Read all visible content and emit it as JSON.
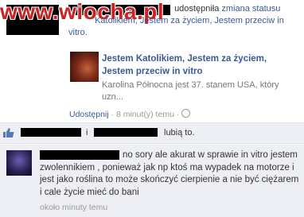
{
  "watermark": {
    "text": "www.wiocha.pl"
  },
  "post": {
    "verb": "udostępniła",
    "link_label": "zmiana statusu",
    "shared_title_visible": "Katolikiem, Jestem za życiem, Jestem przeciw in vitro."
  },
  "link_card": {
    "title": "Jestem Katolikiem, Jestem za życiem, Jestem przeciw in vitro",
    "description": "Karolina Północna jest 37. stanem USA, który uzn..."
  },
  "meta": {
    "share": "Udostępnij",
    "sep": "·",
    "time": "8 minut(y) temu",
    "sep2": "·"
  },
  "likes": {
    "connector": "i",
    "suffix": "lubią to."
  },
  "comment": {
    "text": "no sory ale akurat w sprawie in vitro jestem zwolennikiem , ponieważ jak np ktoś ma wypadek na motorze i jest jako roślina to może skończyć cierpienie a nie być ciężarem i cale życie mieć do bani",
    "time": "około minuty temu"
  },
  "colors": {
    "link": "#3b5998",
    "watermark": "#cc2222",
    "panel": "#edeff4"
  },
  "icons": {
    "like": "thumbs-up-icon",
    "globe": "globe-icon"
  }
}
